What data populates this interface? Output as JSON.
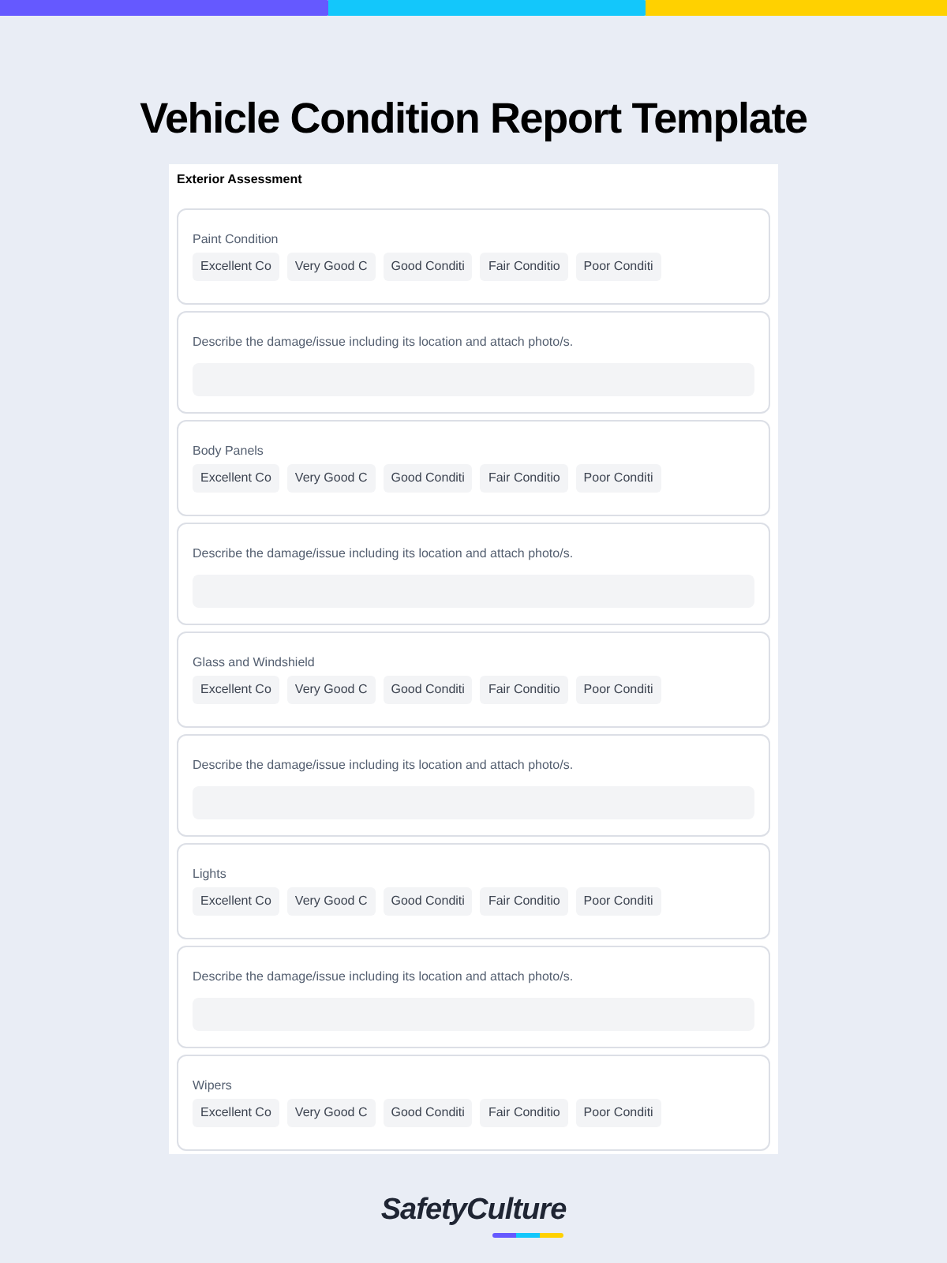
{
  "title": "Vehicle Condition Report Template",
  "form": {
    "section": "Exterior Assessment",
    "items": [
      {
        "kind": "question",
        "label": "Paint Condition",
        "options": [
          "Excellent Co",
          "Very Good C",
          "Good Conditi",
          "Fair Conditio",
          "Poor Conditi"
        ]
      },
      {
        "kind": "describe",
        "label": "Describe the damage/issue including its location and attach photo/s."
      },
      {
        "kind": "question",
        "label": "Body Panels",
        "options": [
          "Excellent Co",
          "Very Good C",
          "Good Conditi",
          "Fair Conditio",
          "Poor Conditi"
        ]
      },
      {
        "kind": "describe",
        "label": "Describe the damage/issue including its location and attach photo/s."
      },
      {
        "kind": "question",
        "label": "Glass and Windshield",
        "options": [
          "Excellent Co",
          "Very Good C",
          "Good Conditi",
          "Fair Conditio",
          "Poor Conditi"
        ]
      },
      {
        "kind": "describe",
        "label": "Describe the damage/issue including its location and attach photo/s."
      },
      {
        "kind": "question",
        "label": "Lights",
        "options": [
          "Excellent Co",
          "Very Good C",
          "Good Conditi",
          "Fair Conditio",
          "Poor Conditi"
        ]
      },
      {
        "kind": "describe",
        "label": "Describe the damage/issue including its location and attach photo/s."
      },
      {
        "kind": "question",
        "label": "Wipers",
        "options": [
          "Excellent Co",
          "Very Good C",
          "Good Conditi",
          "Fair Conditio",
          "Poor Conditi"
        ]
      }
    ]
  },
  "logo": {
    "brand": "SafetyCulture"
  }
}
